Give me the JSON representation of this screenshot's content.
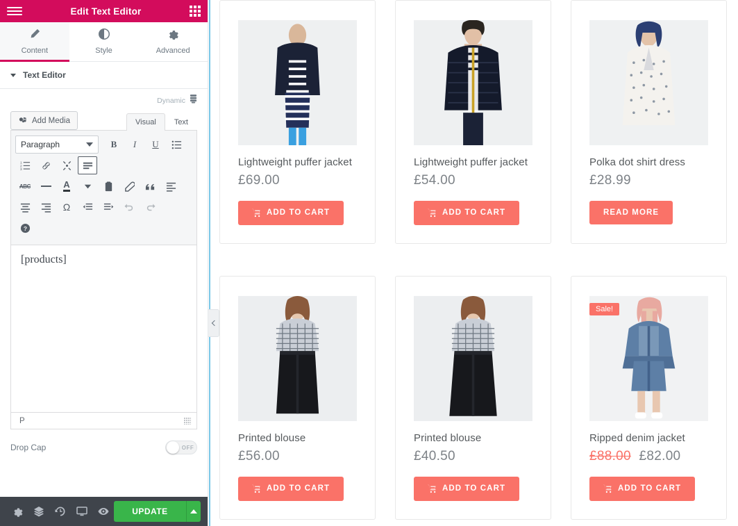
{
  "panel": {
    "header": {
      "title": "Edit Text Editor",
      "menu_icon": "hamburger-icon",
      "grid_icon": "widgets-grid-icon"
    },
    "tabs": [
      {
        "label": "Content",
        "icon": "pencil-icon",
        "active": true
      },
      {
        "label": "Style",
        "icon": "contrast-icon",
        "active": false
      },
      {
        "label": "Advanced",
        "icon": "gear-icon",
        "active": false
      }
    ],
    "section": {
      "title": "Text Editor",
      "collapse_icon": "triangle-down-icon"
    },
    "dynamic": {
      "label": "Dynamic",
      "icon": "database-icon"
    },
    "editor": {
      "add_media_label": "Add Media",
      "add_media_icon": "media-icon",
      "mode_tabs": [
        {
          "label": "Visual",
          "active": true
        },
        {
          "label": "Text",
          "active": false
        }
      ],
      "format_select": "Paragraph",
      "toolbar_row1": [
        "bold-icon",
        "italic-icon",
        "underline-icon",
        "bulleted-list-icon"
      ],
      "toolbar_row2": [
        "numbered-list-icon",
        "link-icon",
        "unlink-icon",
        "toolbar-toggle-icon"
      ],
      "toolbar_row3": [
        "strikethrough-icon",
        "horizontal-rule-icon",
        "text-color-icon",
        "color-caret-icon",
        "paste-as-text-icon",
        "clear-formatting-icon",
        "blockquote-icon",
        "align-left-icon"
      ],
      "toolbar_row4": [
        "align-center-icon",
        "align-right-icon",
        "special-character-icon",
        "decrease-indent-icon",
        "increase-indent-icon",
        "undo-icon",
        "redo-icon"
      ],
      "toolbar_row5": [
        "help-icon"
      ],
      "content": "[products]",
      "status_path": "P",
      "resize_handle": "resize-grip-icon"
    },
    "drop_cap": {
      "label": "Drop Cap",
      "state": "OFF"
    },
    "footer": {
      "icons": [
        "settings-gear-icon",
        "navigator-layers-icon",
        "history-revisions-icon",
        "responsive-mode-icon",
        "preview-eye-icon"
      ],
      "update_label": "UPDATE",
      "update_caret_icon": "caret-up-icon",
      "update_color": "#39b54a"
    },
    "collapse_handle_icon": "chevron-left-icon",
    "accent_color": "#d30c5c"
  },
  "canvas": {
    "accent_button_color": "#fa7268",
    "products": [
      {
        "name": "Lightweight puffer jacket",
        "price": "£69.00",
        "button": "ADD TO CART",
        "button_icon": "cart-icon",
        "on_sale": false,
        "image_alt": "woman-navy-puffer-jacket-striped-dress"
      },
      {
        "name": "Lightweight puffer jacket",
        "price": "£54.00",
        "button": "ADD TO CART",
        "button_icon": "cart-icon",
        "on_sale": false,
        "image_alt": "woman-navy-quilted-puffer-jacket"
      },
      {
        "name": "Polka dot shirt dress",
        "price": "£28.99",
        "button": "READ MORE",
        "button_icon": null,
        "on_sale": false,
        "image_alt": "woman-white-polka-dot-dress-blue-hair"
      },
      {
        "name": "Printed blouse",
        "price": "£56.00",
        "button": "ADD TO CART",
        "button_icon": "cart-icon",
        "on_sale": false,
        "image_alt": "woman-checked-blouse-black-trousers"
      },
      {
        "name": "Printed blouse",
        "price": "£40.50",
        "button": "ADD TO CART",
        "button_icon": "cart-icon",
        "on_sale": false,
        "image_alt": "woman-checked-blouse-black-wide-trousers"
      },
      {
        "name": "Ripped denim jacket",
        "price_old": "£88.00",
        "price": "£82.00",
        "button": "ADD TO CART",
        "button_icon": "cart-icon",
        "on_sale": true,
        "sale_label": "Sale!",
        "image_alt": "woman-denim-jacket-denim-skirt"
      }
    ]
  }
}
